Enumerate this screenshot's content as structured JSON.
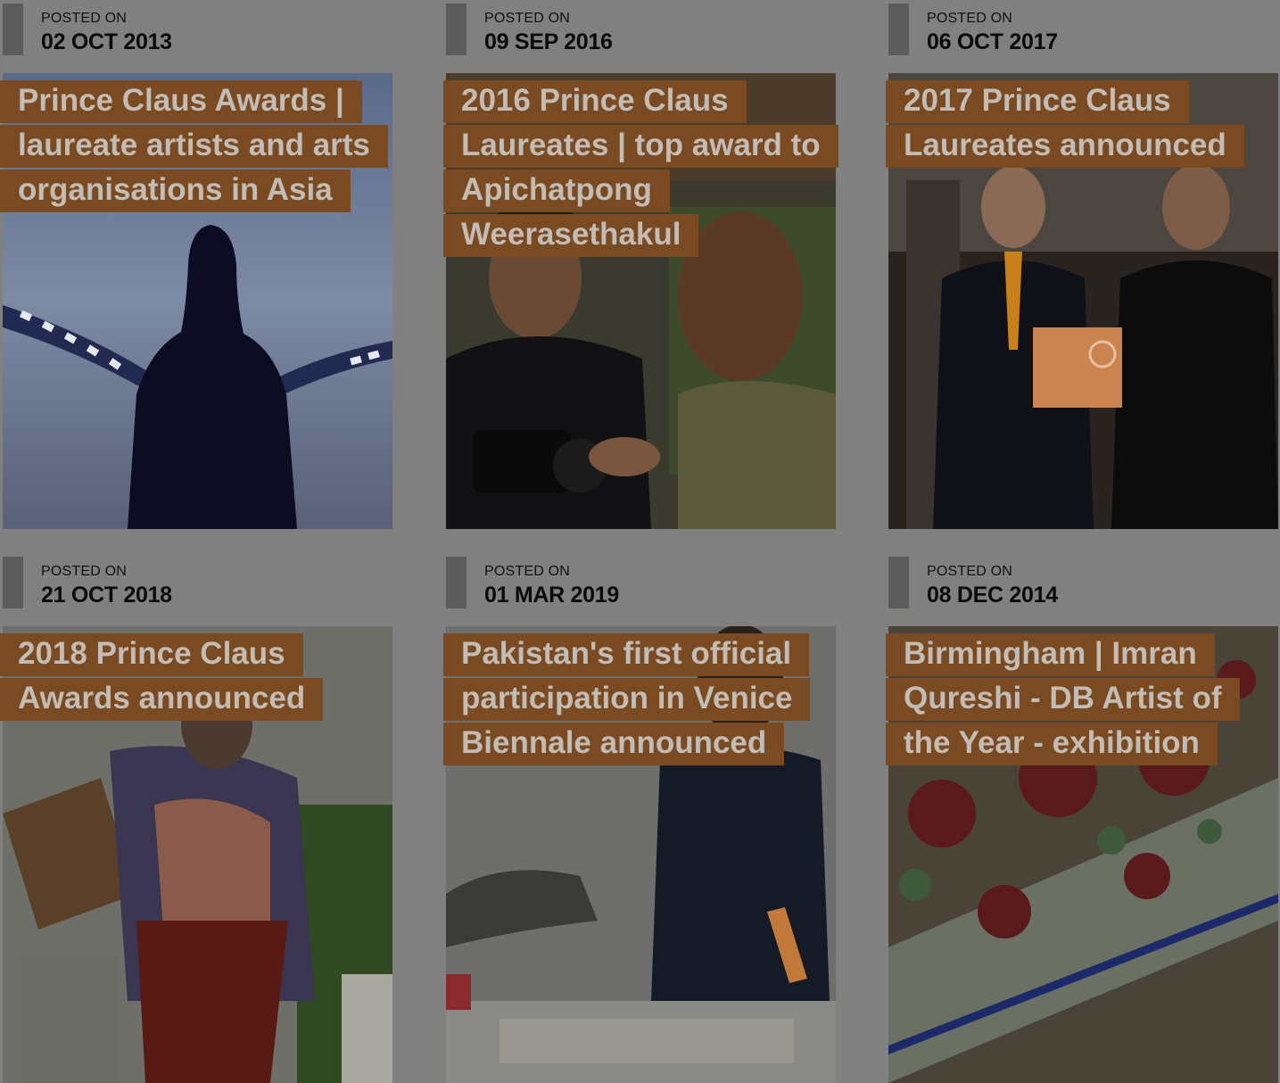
{
  "posts": [
    {
      "posted_label": "POSTED ON",
      "date": "02 OCT 2013",
      "title": "Prince Claus Awards | laureate artists and arts organisations in Asia",
      "image": "silhouette-film-reel"
    },
    {
      "posted_label": "POSTED ON",
      "date": "09 SEP 2016",
      "title": "2016 Prince Claus Laureates | top award to Apichatpong Weerasethakul",
      "image": "filmmaker-with-camera"
    },
    {
      "posted_label": "POSTED ON",
      "date": "06 OCT 2017",
      "title": "2017 Prince Claus Laureates announced",
      "image": "award-handover"
    },
    {
      "posted_label": "POSTED ON",
      "date": "21 OCT 2018",
      "title": "2018 Prince Claus Awards announced",
      "image": "costumed-performer"
    },
    {
      "posted_label": "POSTED ON",
      "date": "01 MAR 2019",
      "title": "Pakistan's first official participation in Venice Biennale announced",
      "image": "artist-painting"
    },
    {
      "posted_label": "POSTED ON",
      "date": "08 DEC 2014",
      "title": "Birmingham | Imran Qureshi - DB Artist of the Year - exhibition",
      "image": "floral-painting"
    }
  ],
  "colors": {
    "title_background": "#7a4a22",
    "title_text": "#c3bcb4",
    "page_background": "#808080"
  }
}
